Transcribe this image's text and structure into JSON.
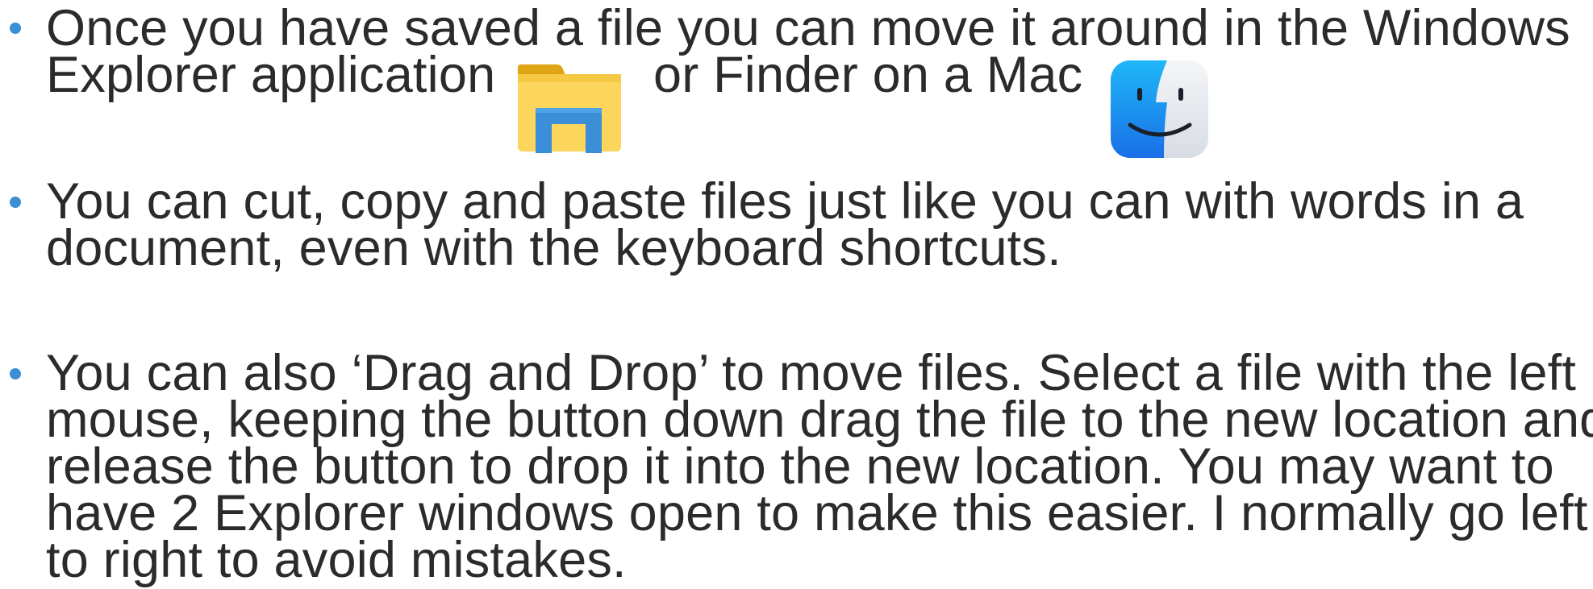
{
  "colors": {
    "text": "#2b2b2b",
    "bullet": "#3b8fd4"
  },
  "bullets": [
    {
      "lines": [
        "Once you have saved a file you can move it around in the Windows",
        "Explorer application"
      ],
      "inline_after_icon": "or Finder on a Mac",
      "icons": [
        "file-explorer-icon",
        "finder-icon"
      ]
    },
    {
      "lines": [
        "You can cut, copy and paste files just like you can with words in a",
        "document, even with the keyboard shortcuts."
      ]
    },
    {
      "lines": [
        "You can also ‘Drag and Drop’ to move files. Select a file with the left",
        "mouse, keeping the button down drag the file to the new location and",
        "release the button to drop it into the new location. You may want to",
        "have 2 Explorer windows open to make this easier.  I normally go left",
        "to right to avoid mistakes."
      ]
    }
  ]
}
